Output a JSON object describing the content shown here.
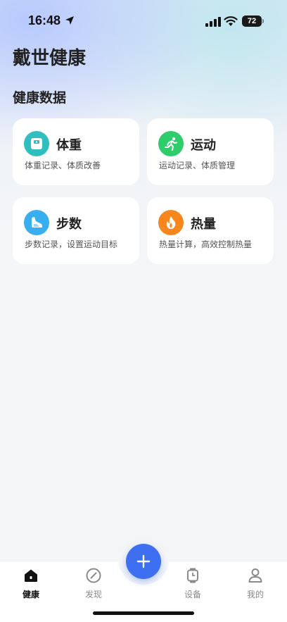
{
  "status_bar": {
    "time": "16:48",
    "battery": "72",
    "icons": [
      "location-arrow-icon",
      "cellular-signal-icon",
      "wifi-icon",
      "battery-icon"
    ]
  },
  "app": {
    "title": "戴世健康"
  },
  "section": {
    "title": "健康数据"
  },
  "cards": [
    {
      "title": "体重",
      "desc": "体重记录、体质改善",
      "icon": "scale-icon",
      "color": "#2fbfbf"
    },
    {
      "title": "运动",
      "desc": "运动记录、体质管理",
      "icon": "running-icon",
      "color": "#2ecc6a"
    },
    {
      "title": "步数",
      "desc": "步数记录，设置运动目标",
      "icon": "shoe-icon",
      "color": "#36aef0"
    },
    {
      "title": "热量",
      "desc": "热量计算，高效控制热量",
      "icon": "flame-icon",
      "color": "#f7861c"
    }
  ],
  "tabs": [
    {
      "label": "健康",
      "icon": "home-icon",
      "active": true
    },
    {
      "label": "发现",
      "icon": "compass-icon",
      "active": false
    },
    {
      "label": "设备",
      "icon": "watch-icon",
      "active": false
    },
    {
      "label": "我的",
      "icon": "person-icon",
      "active": false
    }
  ],
  "fab": {
    "icon": "plus-icon",
    "color": "#3d6ff0"
  }
}
